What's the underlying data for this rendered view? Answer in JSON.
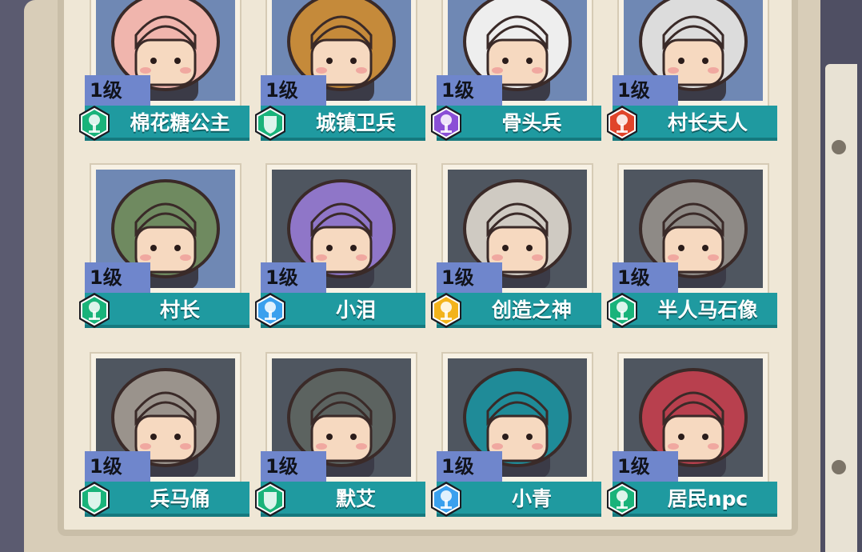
{
  "characters": [
    {
      "level": "1级",
      "name": "棉花糖公主",
      "rank_color": "#19b37a",
      "rank_icon": "tree-icon",
      "portrait_bg": "#6f88b4",
      "hair": "#f0b5ad"
    },
    {
      "level": "1级",
      "name": "城镇卫兵",
      "rank_color": "#19b37a",
      "rank_icon": "shield-icon",
      "portrait_bg": "#6f88b4",
      "hair": "#c58a3a"
    },
    {
      "level": "1级",
      "name": "骨头兵",
      "rank_color": "#8a4fd6",
      "rank_icon": "tree-icon",
      "portrait_bg": "#6f88b4",
      "hair": "#eeeeee"
    },
    {
      "level": "1级",
      "name": "村长夫人",
      "rank_color": "#e0442a",
      "rank_icon": "tree-icon",
      "portrait_bg": "#6f88b4",
      "hair": "#dcdcdc"
    },
    {
      "level": "1级",
      "name": "村长",
      "rank_color": "#19b37a",
      "rank_icon": "tree-icon",
      "portrait_bg": "#6f88b4",
      "hair": "#6f8a60"
    },
    {
      "level": "1级",
      "name": "小泪",
      "rank_color": "#3aa0ee",
      "rank_icon": "tree-icon",
      "portrait_bg": "#4f5660",
      "hair": "#8f76c8"
    },
    {
      "level": "1级",
      "name": "创造之神",
      "rank_color": "#f3b31c",
      "rank_icon": "tree-icon",
      "portrait_bg": "#4f5660",
      "hair": "#cfcac2"
    },
    {
      "level": "1级",
      "name": "半人马石像",
      "rank_color": "#19b37a",
      "rank_icon": "tree-icon",
      "portrait_bg": "#4f5660",
      "hair": "#8e8a86"
    },
    {
      "level": "1级",
      "name": "兵马俑",
      "rank_color": "#19b37a",
      "rank_icon": "shield-icon",
      "portrait_bg": "#4f5660",
      "hair": "#9a938c"
    },
    {
      "level": "1级",
      "name": "默艾",
      "rank_color": "#19b37a",
      "rank_icon": "shield-icon",
      "portrait_bg": "#4f5660",
      "hair": "#5c6360"
    },
    {
      "level": "1级",
      "name": "小青",
      "rank_color": "#3aa0ee",
      "rank_icon": "tree-icon",
      "portrait_bg": "#4f5660",
      "hair": "#1f8b98"
    },
    {
      "level": "1级",
      "name": "居民npc",
      "rank_color": "#19b37a",
      "rank_icon": "tree-icon",
      "portrait_bg": "#4f5660",
      "hair": "#b8404e"
    }
  ]
}
